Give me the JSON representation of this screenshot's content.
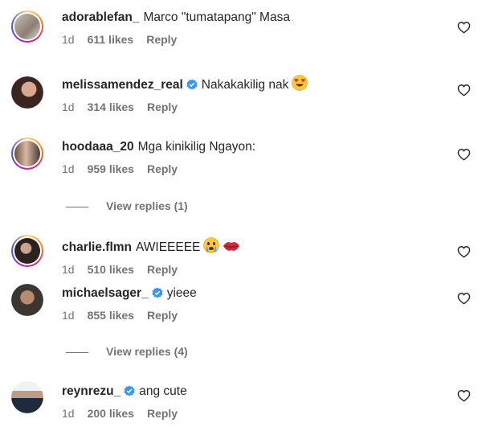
{
  "comments": [
    {
      "username": "adorablefan_",
      "verified": false,
      "text": "Marco \"tumatapang\" Masa",
      "time": "1d",
      "likes": "611 likes",
      "reply": "Reply",
      "avatar": "avatar-adorablefan",
      "emoji": ""
    },
    {
      "username": "melissamendez_real",
      "verified": true,
      "text": "Nakakakilig nak",
      "time": "1d",
      "likes": "314 likes",
      "reply": "Reply",
      "avatar": "avatar-melissamendez",
      "emoji": "heart-eyes-emoji"
    },
    {
      "username": "hoodaaa_20",
      "verified": false,
      "text": "Mga kinikilig Ngayon:",
      "time": "1d",
      "likes": "959 likes",
      "reply": "Reply",
      "avatar": "avatar-hoodaaa",
      "emoji": ""
    },
    {
      "username": "charlie.flmn",
      "verified": false,
      "text": "AWIEEEEE",
      "time": "1d",
      "likes": "510 likes",
      "reply": "Reply",
      "avatar": "avatar-charlie",
      "emoji": "crying-emoji, lips-emoji"
    },
    {
      "username": "michaelsager_",
      "verified": true,
      "text": "yieee",
      "time": "1d",
      "likes": "855 likes",
      "reply": "Reply",
      "avatar": "avatar-michaelsager",
      "emoji": ""
    },
    {
      "username": "reynrezu_",
      "verified": true,
      "text": "ang cute",
      "time": "1d",
      "likes": "200 likes",
      "reply": "Reply",
      "avatar": "avatar-reynrezu",
      "emoji": ""
    }
  ],
  "view_replies": [
    {
      "label": "View replies (1)"
    },
    {
      "label": "View replies (4)"
    }
  ],
  "colors": {
    "verified": "#3897f0",
    "meta": "#737373",
    "text": "#262626"
  },
  "icons": {
    "like": "heart-outline-icon",
    "verified": "verified-badge-icon"
  }
}
